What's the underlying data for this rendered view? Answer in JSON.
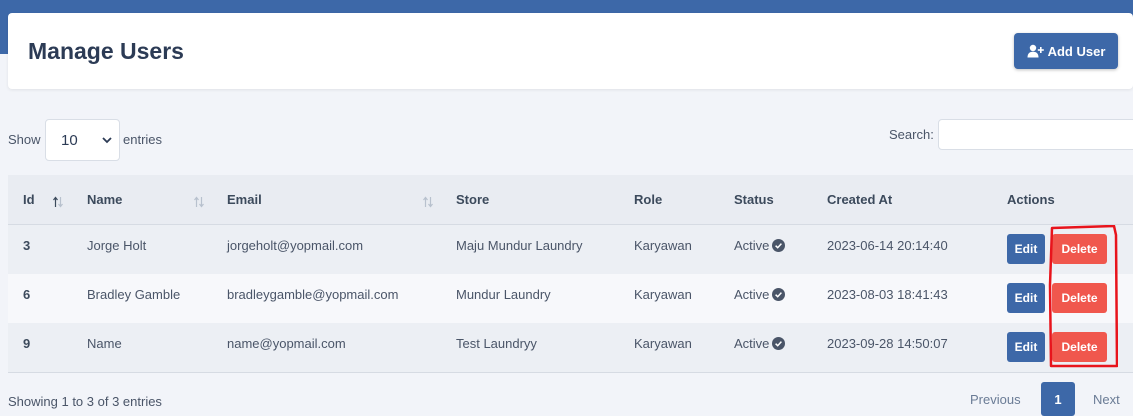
{
  "header": {
    "title": "Manage Users",
    "add_button_label": "Add User",
    "add_button_icon": "user-plus-icon"
  },
  "controls": {
    "show_label": "Show",
    "entries_value": "10",
    "entries_label": "entries",
    "search_label": "Search:",
    "search_value": ""
  },
  "table": {
    "columns": [
      "Id",
      "Name",
      "Email",
      "Store",
      "Role",
      "Status",
      "Created At",
      "Actions"
    ],
    "rows": [
      {
        "id": "3",
        "name": "Jorge Holt",
        "email": "jorgeholt@yopmail.com",
        "store": "Maju Mundur Laundry",
        "role": "Karyawan",
        "status": "Active",
        "created_at": "2023-06-14 20:14:40"
      },
      {
        "id": "6",
        "name": "Bradley Gamble",
        "email": "bradleygamble@yopmail.com",
        "store": "Mundur Laundry",
        "role": "Karyawan",
        "status": "Active",
        "created_at": "2023-08-03 18:41:43"
      },
      {
        "id": "9",
        "name": "Name",
        "email": "name@yopmail.com",
        "store": "Test Laundryy",
        "role": "Karyawan",
        "status": "Active",
        "created_at": "2023-09-28 14:50:07"
      }
    ],
    "edit_label": "Edit",
    "delete_label": "Delete"
  },
  "footer": {
    "info": "Showing 1 to 3 of 3 entries",
    "prev_label": "Previous",
    "current_page": "1",
    "next_label": "Next"
  },
  "colors": {
    "brand": "#3d68a8",
    "danger": "#f0574d",
    "annotation": "#e8141c"
  }
}
